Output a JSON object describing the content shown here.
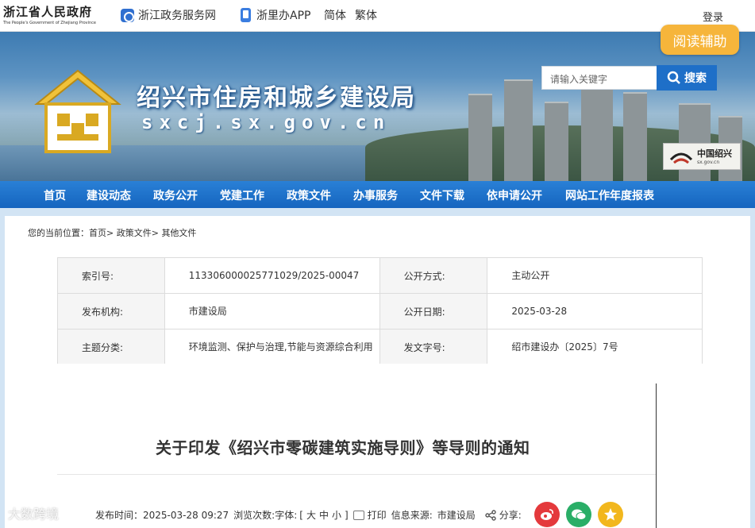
{
  "topbar": {
    "gov_name": "浙江省人民政府",
    "gov_name_en": "The People's Government of Zhejiang Province",
    "service_net": "浙江政务服务网",
    "app": "浙里办APP",
    "simplified": "简体",
    "traditional": "繁体",
    "login": "登录"
  },
  "banner": {
    "title": "绍兴市住房和城乡建设局",
    "domain": "sxcj.sx.gov.cn",
    "search_placeholder": "请输入关键字",
    "search_button": "搜索",
    "city_logo_cn": "中国绍兴",
    "city_logo_url": "sx.gov.cn"
  },
  "read_aid": "阅读辅助",
  "nav": [
    "首页",
    "建设动态",
    "政务公开",
    "党建工作",
    "政策文件",
    "办事服务",
    "文件下载",
    "依申请公开",
    "网站工作年度报表"
  ],
  "breadcrumb": {
    "prefix": "您的当前位置：",
    "items": [
      "首页",
      "政策文件",
      "其他文件"
    ],
    "sep": ">"
  },
  "info": {
    "index_label": "索引号:",
    "index_value": "113306000025771029/2025-00047",
    "open_label": "公开方式:",
    "open_value": "主动公开",
    "org_label": "发布机构:",
    "org_value": "市建设局",
    "date_label": "公开日期:",
    "date_value": "2025-03-28",
    "topic_label": "主题分类:",
    "topic_value": "环境监测、保护与治理,节能与资源综合利用",
    "docno_label": "发文字号:",
    "docno_value": "绍市建设办〔2025〕7号"
  },
  "doc_title": "关于印发《绍兴市零碳建筑实施导则》等导则的通知",
  "meta": {
    "publish_label": "发布时间：",
    "publish_time": "2025-03-28  09:27",
    "views_label": "浏览次数:",
    "font_label": "字体:",
    "font_open": "[",
    "font_large": "大",
    "font_medium": "中",
    "font_small": "小",
    "font_close": "]",
    "print": "打印",
    "source_label": "信息来源:",
    "source_value": "市建设局",
    "share_label": "分享:"
  },
  "watermark": "大数跨境",
  "colors": {
    "nav_blue": "#1b6fc9",
    "search_blue": "#1e6fc8",
    "read_aid_orange": "#f6b53b",
    "weibo_red": "#e4393c",
    "wechat_green": "#2aae67",
    "qzone_yellow": "#f2b71d"
  },
  "icons": [
    "zhejiang-service-icon",
    "phone-app-icon",
    "search-icon",
    "print-icon",
    "share-icon",
    "weibo-icon",
    "wechat-icon",
    "qzone-icon"
  ]
}
